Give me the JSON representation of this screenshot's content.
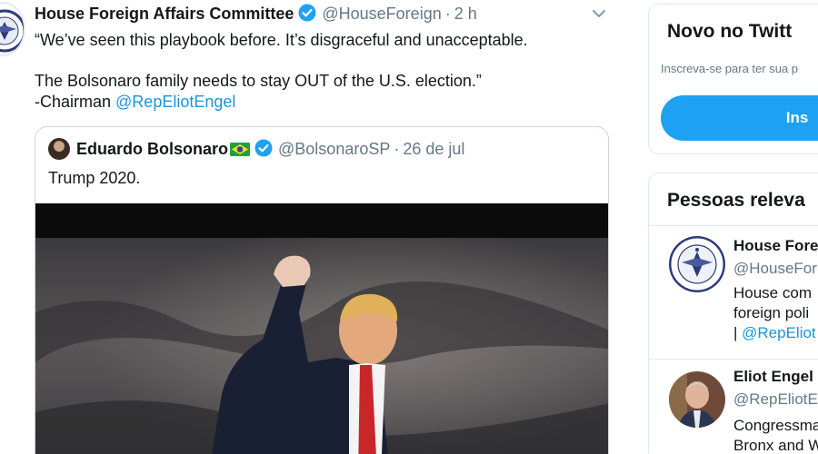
{
  "tweet": {
    "name": "House Foreign Affairs Committee",
    "handle": "@HouseForeign",
    "separator": "·",
    "time": "2 h",
    "lines": [
      "“We’ve seen this playbook before. It’s disgraceful and unacceptable.",
      "The Bolsonaro family needs to stay OUT of the U.S. election.”",
      "-Chairman "
    ],
    "mention": "@RepEliotEngel"
  },
  "quote": {
    "name": "Eduardo Bolsonaro",
    "handle": "@BolsonaroSP",
    "separator": "·",
    "date": "26 de jul",
    "text": "Trump 2020."
  },
  "sidebar": {
    "signup_card": {
      "title": "Novo no Twitt",
      "subtitle": "Inscreva-se para ter sua p",
      "button": "Ins"
    },
    "people_card": {
      "title": "Pessoas releva",
      "people": [
        {
          "name": "House Fore",
          "handle": "@HouseFor",
          "bio": [
            "House com",
            "foreign poli"
          ],
          "bio_prefix": "| ",
          "bio_mention": "@RepEliot"
        },
        {
          "name": "Eliot Engel",
          "handle": "@RepEliotE",
          "bio": [
            "Congressma",
            "Bronx and W"
          ]
        }
      ]
    }
  },
  "colors": {
    "link": "#1b95e0",
    "verified": "#1da1f2",
    "muted": "#657786",
    "text": "#14171a",
    "border": "#e1e8ed"
  },
  "icons": [
    "verified-badge-icon",
    "chevron-down-icon",
    "brazil-flag-icon",
    "committee-seal-icon"
  ]
}
